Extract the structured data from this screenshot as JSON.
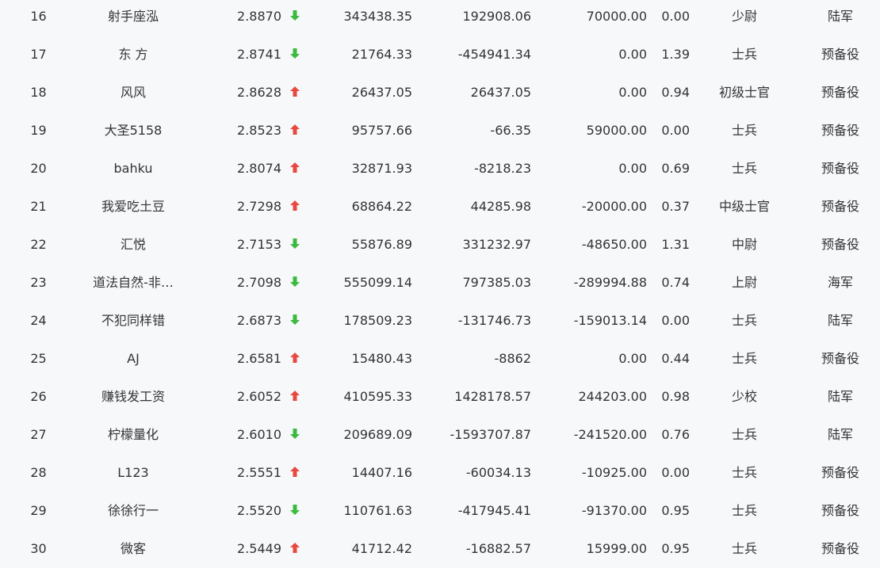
{
  "colors": {
    "up": "#e8483f",
    "down": "#3cba3f",
    "text": "#333333",
    "background": "#f6f8fa"
  },
  "rows": [
    {
      "rank": "16",
      "name": "射手座泓",
      "score": "2.8870",
      "trend": "down",
      "trend_icon": "arrow-down-icon",
      "v1": "343438.35",
      "v2": "192908.06",
      "v3": "70000.00",
      "v4": "0.00",
      "title": "少尉",
      "branch": "陆军"
    },
    {
      "rank": "17",
      "name": "东 方",
      "score": "2.8741",
      "trend": "down",
      "trend_icon": "arrow-down-icon",
      "v1": "21764.33",
      "v2": "-454941.34",
      "v3": "0.00",
      "v4": "1.39",
      "title": "士兵",
      "branch": "预备役"
    },
    {
      "rank": "18",
      "name": "风风",
      "score": "2.8628",
      "trend": "up",
      "trend_icon": "arrow-up-icon",
      "v1": "26437.05",
      "v2": "26437.05",
      "v3": "0.00",
      "v4": "0.94",
      "title": "初级士官",
      "branch": "预备役"
    },
    {
      "rank": "19",
      "name": "大圣5158",
      "score": "2.8523",
      "trend": "up",
      "trend_icon": "arrow-up-icon",
      "v1": "95757.66",
      "v2": "-66.35",
      "v3": "59000.00",
      "v4": "0.00",
      "title": "士兵",
      "branch": "预备役"
    },
    {
      "rank": "20",
      "name": "bahku",
      "score": "2.8074",
      "trend": "up",
      "trend_icon": "arrow-up-icon",
      "v1": "32871.93",
      "v2": "-8218.23",
      "v3": "0.00",
      "v4": "0.69",
      "title": "士兵",
      "branch": "预备役"
    },
    {
      "rank": "21",
      "name": "我爱吃土豆",
      "score": "2.7298",
      "trend": "up",
      "trend_icon": "arrow-up-icon",
      "v1": "68864.22",
      "v2": "44285.98",
      "v3": "-20000.00",
      "v4": "0.37",
      "title": "中级士官",
      "branch": "预备役"
    },
    {
      "rank": "22",
      "name": "汇悦",
      "score": "2.7153",
      "trend": "down",
      "trend_icon": "arrow-down-icon",
      "v1": "55876.89",
      "v2": "331232.97",
      "v3": "-48650.00",
      "v4": "1.31",
      "title": "中尉",
      "branch": "预备役"
    },
    {
      "rank": "23",
      "name": "道法自然-非…",
      "score": "2.7098",
      "trend": "down",
      "trend_icon": "arrow-down-icon",
      "v1": "555099.14",
      "v2": "797385.03",
      "v3": "-289994.88",
      "v4": "0.74",
      "title": "上尉",
      "branch": "海军"
    },
    {
      "rank": "24",
      "name": "不犯同样错",
      "score": "2.6873",
      "trend": "down",
      "trend_icon": "arrow-down-icon",
      "v1": "178509.23",
      "v2": "-131746.73",
      "v3": "-159013.14",
      "v4": "0.00",
      "title": "士兵",
      "branch": "陆军"
    },
    {
      "rank": "25",
      "name": "AJ",
      "score": "2.6581",
      "trend": "up",
      "trend_icon": "arrow-up-icon",
      "v1": "15480.43",
      "v2": "-8862",
      "v3": "0.00",
      "v4": "0.44",
      "title": "士兵",
      "branch": "预备役"
    },
    {
      "rank": "26",
      "name": "赚钱发工资",
      "score": "2.6052",
      "trend": "up",
      "trend_icon": "arrow-up-icon",
      "v1": "410595.33",
      "v2": "1428178.57",
      "v3": "244203.00",
      "v4": "0.98",
      "title": "少校",
      "branch": "陆军"
    },
    {
      "rank": "27",
      "name": "柠檬量化",
      "score": "2.6010",
      "trend": "down",
      "trend_icon": "arrow-down-icon",
      "v1": "209689.09",
      "v2": "-1593707.87",
      "v3": "-241520.00",
      "v4": "0.76",
      "title": "士兵",
      "branch": "陆军"
    },
    {
      "rank": "28",
      "name": "L123",
      "score": "2.5551",
      "trend": "up",
      "trend_icon": "arrow-up-icon",
      "v1": "14407.16",
      "v2": "-60034.13",
      "v3": "-10925.00",
      "v4": "0.00",
      "title": "士兵",
      "branch": "预备役"
    },
    {
      "rank": "29",
      "name": "徐徐行一",
      "score": "2.5520",
      "trend": "down",
      "trend_icon": "arrow-down-icon",
      "v1": "110761.63",
      "v2": "-417945.41",
      "v3": "-91370.00",
      "v4": "0.95",
      "title": "士兵",
      "branch": "预备役"
    },
    {
      "rank": "30",
      "name": "微客",
      "score": "2.5449",
      "trend": "up",
      "trend_icon": "arrow-up-icon",
      "v1": "41712.42",
      "v2": "-16882.57",
      "v3": "15999.00",
      "v4": "0.95",
      "title": "士兵",
      "branch": "预备役"
    }
  ]
}
